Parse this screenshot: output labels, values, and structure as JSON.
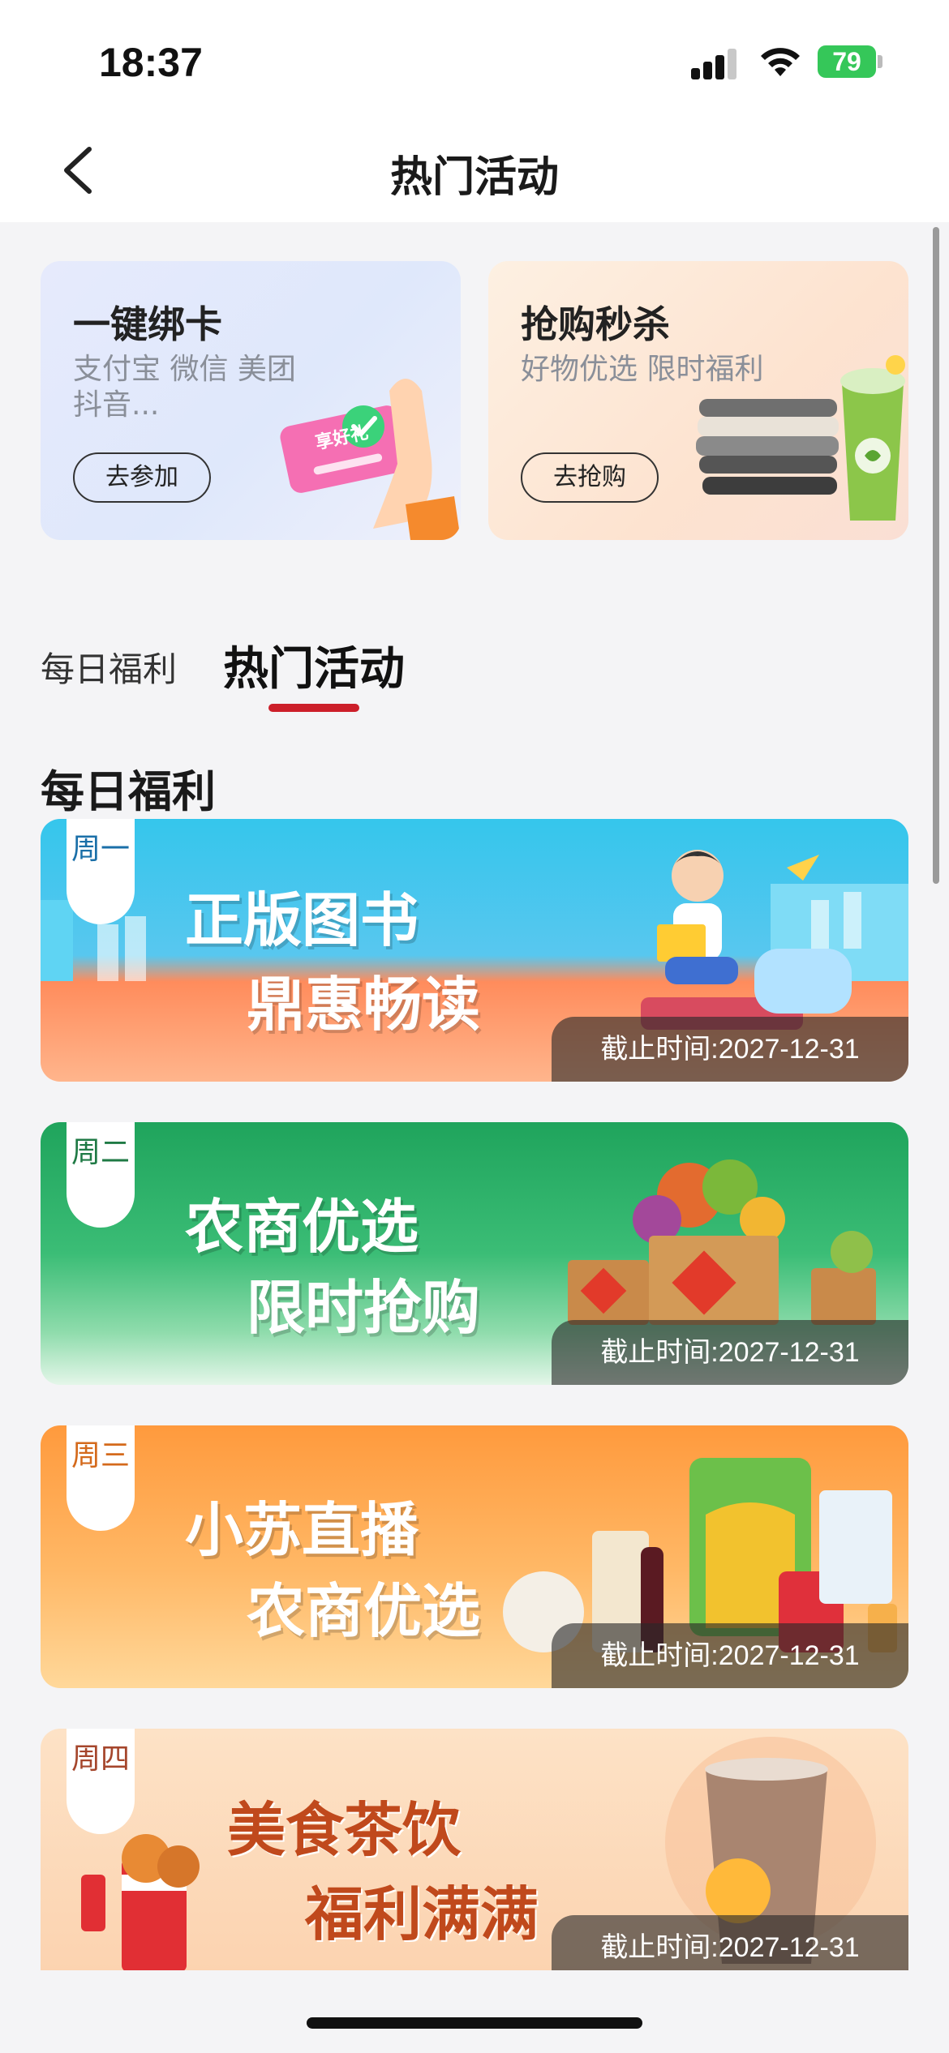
{
  "status_bar": {
    "time": "18:37",
    "battery": "79"
  },
  "nav": {
    "title": "热门活动"
  },
  "promos": [
    {
      "title": "一键绑卡",
      "subtitle": "支付宝 微信 美团 抖音...",
      "button": "去参加",
      "badge": "享好礼"
    },
    {
      "title": "抢购秒杀",
      "subtitle": "好物优选 限时福利",
      "button": "去抢购"
    }
  ],
  "tabs": [
    {
      "label": "每日福利",
      "active": false
    },
    {
      "label": "热门活动",
      "active": true
    }
  ],
  "section": {
    "title": "每日福利"
  },
  "banners": [
    {
      "day": "周一",
      "line1": "正版图书",
      "line2": "鼎惠畅读",
      "deadline": "截止时间:2027-12-31"
    },
    {
      "day": "周二",
      "line1": "农商优选",
      "line2": "限时抢购",
      "deadline": "截止时间:2027-12-31"
    },
    {
      "day": "周三",
      "line1": "小苏直播",
      "line2": "农商优选",
      "deadline": "截止时间:2027-12-31"
    },
    {
      "day": "周四",
      "line1": "美食茶饮",
      "line2": "福利满满",
      "deadline": "截止时间:2027-12-31"
    }
  ],
  "colors": {
    "accent": "#cc1f2a",
    "battery": "#35c759"
  }
}
